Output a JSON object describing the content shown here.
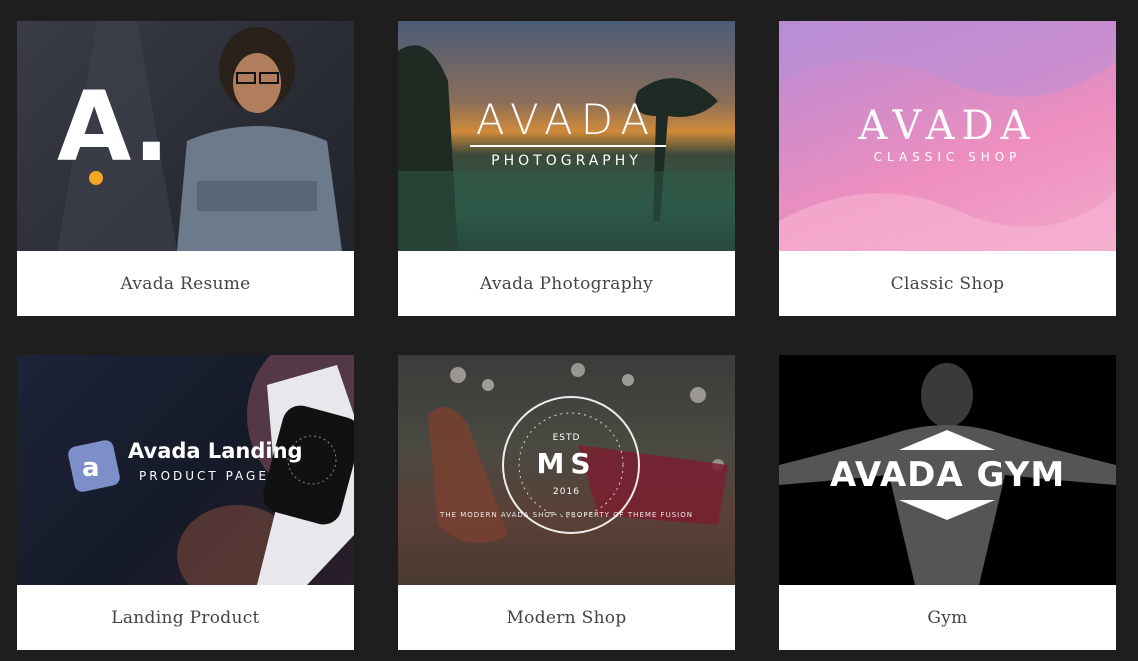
{
  "cards": [
    {
      "title": "Avada Resume",
      "logo": "A."
    },
    {
      "title": "Avada Photography",
      "logo_main": "AVADA",
      "logo_sub": "PHOTOGRAPHY"
    },
    {
      "title": "Classic Shop",
      "logo_main": "AVADA",
      "logo_sub": "CLASSIC SHOP"
    },
    {
      "title": "Landing Product",
      "logo_main": "Avada Landing",
      "logo_sub": "PRODUCT PAGE"
    },
    {
      "title": "Modern Shop",
      "logo_main": "MS",
      "logo_ring": "THE MODERN AVADA SHOP · PROPERTY OF THEME FUSION",
      "logo_estd": "ESTD",
      "logo_year": "2016"
    },
    {
      "title": "Gym",
      "logo_main": "AVADA GYM"
    }
  ],
  "colors": {
    "page_bg": "#1e1e1e",
    "card_bg": "#ffffff",
    "caption_text": "#444444",
    "accent_orange": "#f5a623"
  }
}
